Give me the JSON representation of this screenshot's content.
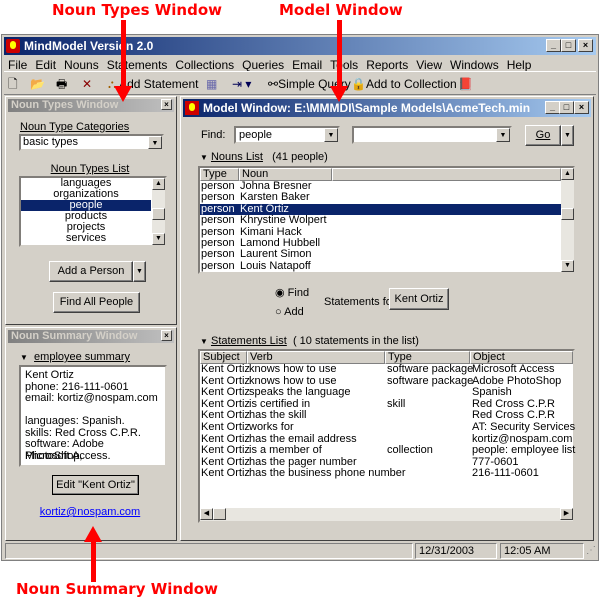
{
  "annotations": {
    "noun_types": "Noun Types Window",
    "model": "Model Window",
    "noun_summary": "Noun Summary Window",
    "color": "#ff0000"
  },
  "app": {
    "title": "MindModel Version 2.0",
    "menu": [
      "File",
      "Edit",
      "Nouns",
      "Statements",
      "Collections",
      "Queries",
      "Email",
      "Tools",
      "Reports",
      "View",
      "Windows",
      "Help"
    ],
    "toolbar": {
      "add_statement": "Add Statement",
      "simple_query": "Simple Query",
      "add_to_collection": "Add to Collection"
    },
    "status": {
      "date": "12/31/2003",
      "time": "12:05 AM"
    }
  },
  "noun_types": {
    "title": "Noun Types Window",
    "categories_label": "Noun Type Categories",
    "category_value": "basic types",
    "list_label": "Noun Types List",
    "items": [
      "languages",
      "organizations",
      "people",
      "products",
      "projects",
      "services"
    ],
    "selected": "people",
    "add_button": "Add a Person",
    "find_all_button": "Find All People"
  },
  "noun_summary": {
    "title": "Noun Summary Window",
    "section": "employee summary",
    "lines": [
      "Kent Ortiz",
      "phone: 216-111-0601",
      "email: kortiz@nospam.com",
      "",
      "languages: Spanish.",
      "skills: Red Cross C.P.R.",
      "software: Adobe PhotoShop,",
      "Microsoft Access."
    ],
    "edit_button": "Edit \"Kent Ortiz\"",
    "email_link": "kortiz@nospam.com"
  },
  "model": {
    "title": "Model Window: E:\\MMMDI\\Sample Models\\AcmeTech.min",
    "find_label": "Find:",
    "find_value": "people",
    "find_value2": "",
    "go_button": "Go",
    "nouns_label": "Nouns List",
    "nouns_count": "(41 people)",
    "nouns_columns": [
      "Type",
      "Noun"
    ],
    "nouns": [
      [
        "person",
        "Johna Bresner"
      ],
      [
        "person",
        "Karsten Baker"
      ],
      [
        "person",
        "Kent Ortiz"
      ],
      [
        "person",
        "Khrystine Wolpert"
      ],
      [
        "person",
        "Kimani Hack"
      ],
      [
        "person",
        "Lamond Hubbell"
      ],
      [
        "person",
        "Laurent Simon"
      ],
      [
        "person",
        "Louis Natapoff"
      ]
    ],
    "nouns_selected": 2,
    "radio_find": "Find",
    "radio_add": "Add",
    "radio_selected": "Find",
    "statements_for": "Statements for",
    "statements_for_button": "Kent Ortiz",
    "statements_label": "Statements List",
    "statements_count": "( 10 statements in the list)",
    "statements_columns": [
      "Subject",
      "Verb",
      "Type",
      "Object"
    ],
    "statements": [
      [
        "Kent Ortiz",
        "knows how to use",
        "software package",
        "Microsoft Access"
      ],
      [
        "Kent Ortiz",
        "knows how to use",
        "software package",
        "Adobe PhotoShop"
      ],
      [
        "Kent Ortiz",
        "speaks the language",
        "",
        "Spanish"
      ],
      [
        "Kent Ortiz",
        "is certified in",
        "skill",
        "Red Cross C.P.R"
      ],
      [
        "Kent Ortiz",
        "has the skill",
        "",
        "Red Cross C.P.R"
      ],
      [
        "Kent Ortiz",
        "works for",
        "",
        "AT: Security Services"
      ],
      [
        "Kent Ortiz",
        "has the email address",
        "",
        "kortiz@nospam.com"
      ],
      [
        "Kent Ortiz",
        "is a member of",
        "collection",
        "people: employee list"
      ],
      [
        "Kent Ortiz",
        "has the pager number",
        "",
        "777-0601"
      ],
      [
        "Kent Ortiz",
        "has the business phone number",
        "",
        "216-111-0601"
      ]
    ]
  }
}
